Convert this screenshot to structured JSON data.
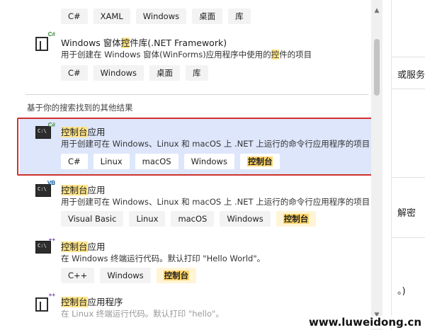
{
  "top_tags": [
    "C#",
    "XAML",
    "Windows",
    "桌面",
    "库"
  ],
  "winforms": {
    "title_pre": "Windows 窗体",
    "title_hl": "控",
    "title_post": "件库(.NET Framework)",
    "desc_pre": "用于创建在 Windows 窗体(WinForms)应用程序中使用的",
    "desc_hl": "控",
    "desc_post": "件的项目",
    "tags": [
      "C#",
      "Windows",
      "桌面",
      "库"
    ]
  },
  "section_header": "基于你的搜索找到的其他结果",
  "items": [
    {
      "badge": "C#",
      "title_hl": "控制台",
      "title_post": "应用",
      "desc": "用于创建可在 Windows、Linux 和 macOS 上 .NET 上运行的命令行应用程序的项目",
      "tags": [
        "C#",
        "Linux",
        "macOS",
        "Windows"
      ],
      "tag_hl": "控制台"
    },
    {
      "badge": "VB",
      "title_hl": "控制台",
      "title_post": "应用",
      "desc": "用于创建可在 Windows、Linux 和 macOS 上 .NET 上运行的命令行应用程序的项目",
      "tags": [
        "Visual Basic",
        "Linux",
        "macOS",
        "Windows"
      ],
      "tag_hl": "控制台"
    },
    {
      "badge": "++",
      "title_hl": "控制台",
      "title_post": "应用",
      "desc": "在 Windows 终端运行代码。默认打印 \"Hello World\"。",
      "tags": [
        "C++",
        "Windows"
      ],
      "tag_hl": "控制台"
    },
    {
      "badge": "++",
      "title_hl": "控制台",
      "title_post": "应用程序",
      "desc": "在 Linux 终端运行代码。默认打印 \"hello\"。"
    }
  ],
  "right_pane": {
    "text1": "或服务",
    "text2": "解密",
    "text3": "。)"
  },
  "watermark": "www.luweidong.cn"
}
